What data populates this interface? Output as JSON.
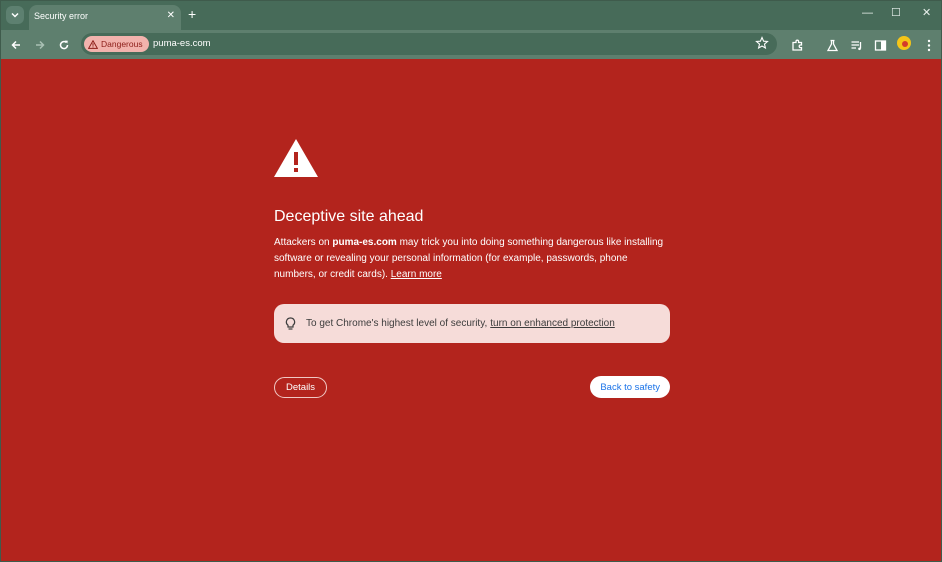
{
  "tab": {
    "title": "Security error",
    "close_symbol": "✕",
    "new_tab_symbol": "+"
  },
  "window_controls": {
    "minimize": "—",
    "maximize": "☐",
    "close": "✕"
  },
  "omnibox": {
    "chip_label": "Dangerous",
    "url": "puma-es.com"
  },
  "colors": {
    "page_background": "#b3241d",
    "tab_strip": "#476b59",
    "toolbar": "#5e7f6e",
    "chip_background": "#f2b3ad",
    "banner_background": "#f6dcd9",
    "primary_button_text": "#1a73e8"
  },
  "icons": {
    "tab_search": "chevron-down-icon",
    "back": "arrow-left-icon",
    "forward": "arrow-right-icon",
    "reload": "reload-icon",
    "warning": "warning-triangle-icon",
    "bookmark": "star-icon",
    "extensions": "puzzle-icon",
    "labs": "flask-icon",
    "media": "media-queue-icon",
    "side_panel": "side-panel-icon",
    "menu": "kebab-menu-icon",
    "tip": "lightbulb-icon"
  },
  "interstitial": {
    "heading": "Deceptive site ahead",
    "body_prefix": "Attackers on ",
    "domain": "puma-es.com",
    "body_suffix": " may trick you into doing something dangerous like installing software or revealing your personal information (for example, passwords, phone numbers, or credit cards). ",
    "learn_more": "Learn more",
    "banner_text": "To get Chrome's highest level of security,",
    "banner_link": "turn on enhanced protection",
    "details_button": "Details",
    "back_button": "Back to safety"
  }
}
